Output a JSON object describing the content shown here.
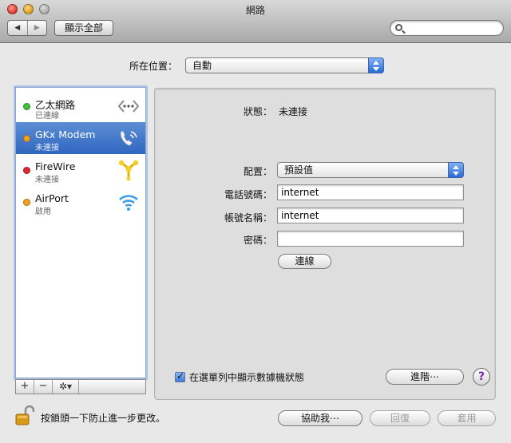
{
  "window": {
    "title": "網路"
  },
  "toolbar": {
    "back_label": "◀",
    "forward_label": "▶",
    "show_all_label": "顯示全部",
    "search_value": "",
    "search_placeholder": ""
  },
  "location": {
    "label": "所在位置：",
    "value": "自動"
  },
  "services": [
    {
      "name": "乙太網路",
      "status": "已連線",
      "dot_color": "#3fbf3a",
      "icon": "ethernet-icon"
    },
    {
      "name": "GKx Modem",
      "status": "未連接",
      "dot_color": "#f2a31c",
      "icon": "modem-phone-icon",
      "selected": true
    },
    {
      "name": "FireWire",
      "status": "未連接",
      "dot_color": "#e0262e",
      "icon": "firewire-icon"
    },
    {
      "name": "AirPort",
      "status": "啟用",
      "dot_color": "#f2a31c",
      "icon": "airport-wifi-icon"
    }
  ],
  "list_controls": {
    "add": "+",
    "remove": "−",
    "action": "✲▾"
  },
  "detail": {
    "status_label": "狀態：",
    "status_value": "未連接",
    "config_label": "配置：",
    "config_value": "預設值",
    "phone_label": "電話號碼：",
    "phone_value": "internet",
    "account_label": "帳號名稱：",
    "account_value": "internet",
    "password_label": "密碼：",
    "password_value": "",
    "connect_label": "連線",
    "show_status_label": "在選單列中顯示數據機狀態",
    "advanced_label": "進階⋯",
    "help_label": "?"
  },
  "footer": {
    "lock_text": "按鎖頭一下防止進一步更改。",
    "assist_label": "協助我⋯",
    "revert_label": "回復",
    "apply_label": "套用"
  },
  "colors": {
    "selection": "#3f77c9",
    "connected": "#3fbf3a",
    "inactive": "#f2a31c",
    "disconnected": "#e0262e"
  }
}
